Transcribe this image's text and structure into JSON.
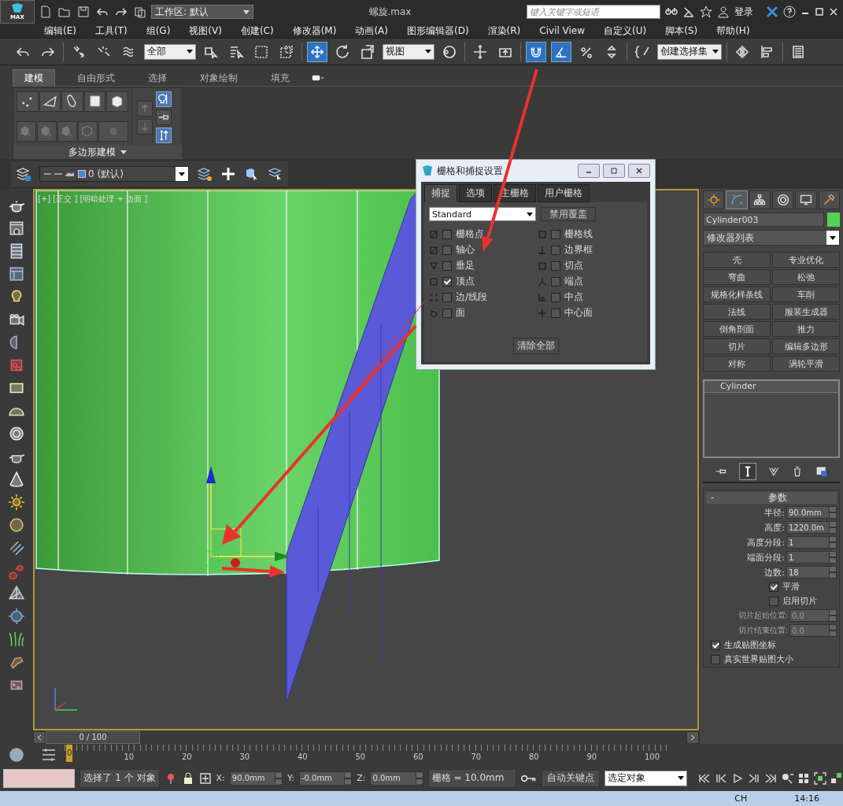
{
  "title_bar": {
    "logo": "MAX",
    "workspace": "工作区: 默认",
    "title": "螺旋.max",
    "search": {
      "placeholder": "键入关键字或短语"
    },
    "login": "登录"
  },
  "menu": [
    "编辑(E)",
    "工具(T)",
    "组(G)",
    "视图(V)",
    "创建(C)",
    "修改器(M)",
    "动画(A)",
    "图形编辑器(D)",
    "渲染(R)",
    "Civil View",
    "自定义(U)",
    "脚本(S)",
    "帮助(H)"
  ],
  "main_toolbar": [
    {
      "kind": "tool",
      "active": false
    },
    {
      "kind": "tool",
      "active": false
    },
    {
      "kind": "sep"
    },
    {
      "kind": "tool",
      "active": false
    },
    {
      "kind": "tool",
      "active": false
    },
    {
      "kind": "tool",
      "active": false
    },
    {
      "kind": "dropdown",
      "value": "全部"
    },
    {
      "kind": "tool",
      "active": false
    },
    {
      "kind": "tool",
      "active": false
    },
    {
      "kind": "tool",
      "active": false
    },
    {
      "kind": "tool",
      "active": false
    },
    {
      "kind": "sep"
    },
    {
      "kind": "tool",
      "active": true
    },
    {
      "kind": "tool",
      "active": false
    },
    {
      "kind": "tool",
      "active": false
    },
    {
      "kind": "dropdown",
      "value": "视图"
    },
    {
      "kind": "tool",
      "active": false
    },
    {
      "kind": "sep"
    },
    {
      "kind": "tool",
      "active": false
    },
    {
      "kind": "tool",
      "active": false
    },
    {
      "kind": "sep"
    },
    {
      "kind": "tool",
      "active": true
    },
    {
      "kind": "tool",
      "active": true
    },
    {
      "kind": "tool",
      "active": false
    },
    {
      "kind": "tool",
      "active": false
    },
    {
      "kind": "sep"
    },
    {
      "kind": "tool",
      "active": false
    },
    {
      "kind": "dropdown",
      "value": "创建选择集"
    },
    {
      "kind": "sep"
    },
    {
      "kind": "tool",
      "active": false
    },
    {
      "kind": "tool",
      "active": false
    },
    {
      "kind": "sep"
    },
    {
      "kind": "tool",
      "active": false
    }
  ],
  "ribbon": {
    "tabs": [
      {
        "label": "建模",
        "selected": true
      },
      {
        "label": "自由形式",
        "selected": false
      },
      {
        "label": "选择",
        "selected": false
      },
      {
        "label": "对象绘制",
        "selected": false
      },
      {
        "label": "填充",
        "selected": false
      }
    ],
    "panel_label": "多边形建模"
  },
  "layer_bar": {
    "layer": "0 (默认)"
  },
  "viewport": {
    "label": "[+] [正交 ] [明暗处理 + 边面 ]"
  },
  "snap_dialog": {
    "title": "栅格和捕捉设置",
    "tabs": [
      {
        "label": "捕捉",
        "selected": true
      },
      {
        "label": "选项",
        "selected": false
      },
      {
        "label": "主栅格",
        "selected": false
      },
      {
        "label": "用户栅格",
        "selected": false
      }
    ],
    "preset": "Standard",
    "override_button": "禁用覆盖",
    "snaps": [
      {
        "label": "栅格点",
        "checked": false
      },
      {
        "label": "栅格线",
        "checked": false
      },
      {
        "label": "轴心",
        "checked": false
      },
      {
        "label": "边界框",
        "checked": false
      },
      {
        "label": "垂足",
        "checked": false
      },
      {
        "label": "切点",
        "checked": false
      },
      {
        "label": "顶点",
        "checked": true
      },
      {
        "label": "端点",
        "checked": false
      },
      {
        "label": "边/线段",
        "checked": false
      },
      {
        "label": "中点",
        "checked": false
      },
      {
        "label": "面",
        "checked": false
      },
      {
        "label": "中心面",
        "checked": false
      }
    ],
    "clear_button": "清除全部"
  },
  "command_panel": {
    "tabs": [
      {
        "selected": false
      },
      {
        "selected": true
      },
      {
        "selected": false
      },
      {
        "selected": false
      },
      {
        "selected": false
      },
      {
        "selected": false
      }
    ],
    "object_name": "Cylinder003",
    "modifier_list": "修改器列表",
    "modifiers": [
      "壳",
      "专业优化",
      "弯曲",
      "松弛",
      "规格化样条线",
      "车削",
      "法线",
      "服装生成器",
      "倒角剖面",
      "推力",
      "切片",
      "编辑多边形",
      "对称",
      "涡轮平滑"
    ],
    "stack": [
      "Cylinder"
    ],
    "rollout_sign": "-",
    "rollout_title": "参数",
    "params": [
      {
        "label": "半径:",
        "value": "90.0mm",
        "disabled": false
      },
      {
        "label": "高度:",
        "value": "1220.0m",
        "disabled": false
      },
      {
        "label": "高度分段:",
        "value": "1",
        "disabled": false
      },
      {
        "label": "端面分段:",
        "value": "1",
        "disabled": false
      },
      {
        "label": "边数:",
        "value": "18",
        "disabled": false
      }
    ],
    "smooth": {
      "label": "平滑",
      "checked": true
    },
    "slice": {
      "label": "启用切片",
      "checked": false
    },
    "slice_params": [
      {
        "label": "切片起始位置:",
        "value": "0.0",
        "disabled": true
      },
      {
        "label": "切片结束位置:",
        "value": "0.0",
        "disabled": true
      }
    ],
    "options": [
      {
        "label": "生成贴图坐标",
        "checked": true
      },
      {
        "label": "真实世界贴图大小",
        "checked": false
      }
    ]
  },
  "timeline": {
    "position": "0 / 100",
    "ticks": [
      "0",
      "10",
      "20",
      "30",
      "40",
      "50",
      "60",
      "70",
      "80",
      "90",
      "100"
    ]
  },
  "status_bar": {
    "selection": "选择了 1 个 对象",
    "coords": [
      {
        "label": "X:",
        "value": "90.0mm"
      },
      {
        "label": "Y:",
        "value": "-0.0mm"
      },
      {
        "label": "Z:",
        "value": "0.0mm"
      }
    ],
    "grid": "栅格 = 10.0mm",
    "auto_key": "自动关键点",
    "key_filter": "选定对象"
  },
  "taskbar": {
    "language": "CH",
    "time": "14:16"
  }
}
